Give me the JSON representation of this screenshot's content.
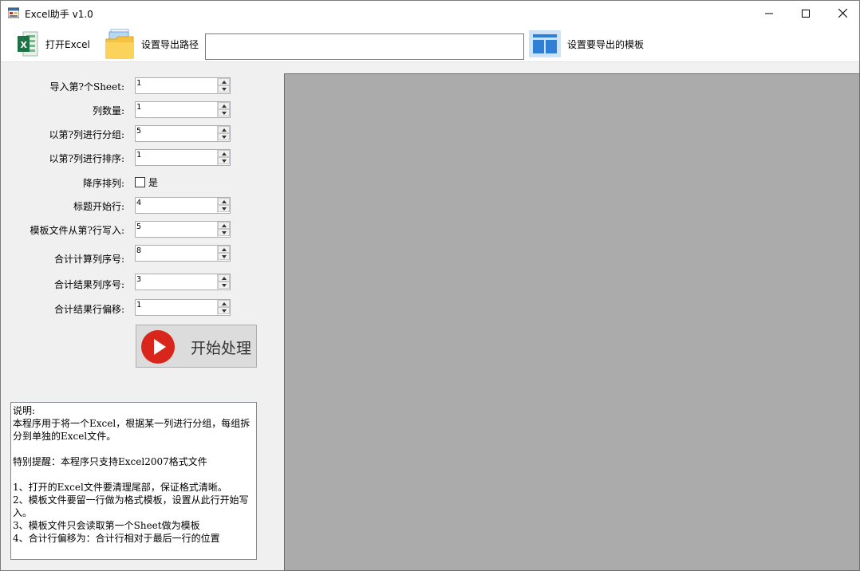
{
  "window": {
    "title": "Excel助手 v1.0"
  },
  "toolbar": {
    "open_excel_label": "打开Excel",
    "set_export_path_label": "设置导出路径",
    "export_path_value": "",
    "set_template_label": "设置要导出的模板"
  },
  "form": {
    "sheet_index": {
      "label": "导入第?个Sheet:",
      "value": "1"
    },
    "column_count": {
      "label": "列数量:",
      "value": "1"
    },
    "group_column": {
      "label": "以第?列进行分组:",
      "value": "5"
    },
    "sort_column": {
      "label": "以第?列进行排序:",
      "value": "1"
    },
    "descending": {
      "label": "降序排列:",
      "checkbox_label": "是",
      "checked": false
    },
    "header_start_row": {
      "label": "标题开始行:",
      "value": "4"
    },
    "template_write_row": {
      "label": "模板文件从第?行写入:",
      "value": "5"
    },
    "sum_calc_column": {
      "label": "合计计算列序号:",
      "value": "8"
    },
    "sum_result_column": {
      "label": "合计结果列序号:",
      "value": "3"
    },
    "sum_result_row_offset": {
      "label": "合计结果行偏移:",
      "value": "1"
    }
  },
  "start_button": {
    "label": "开始处理"
  },
  "notes": {
    "text": "说明:\n本程序用于将一个Excel，根据某一列进行分组，每组拆分到单独的Excel文件。\n\n特别提醒：本程序只支持Excel2007格式文件\n\n1、打开的Excel文件要清理尾部，保证格式清晰。\n2、模板文件要留一行做为格式模板，设置从此行开始写入。\n3、模板文件只会读取第一个Sheet做为模板\n4、合计行偏移为：合计行相对于最后一行的位置"
  },
  "colors": {
    "excel_green": "#1e7145",
    "folder_yellow": "#f5c242",
    "template_blue": "#2f7fd6",
    "start_red": "#d9261c",
    "preview_gray": "#ababab"
  },
  "icons": {
    "app": "app-icon",
    "open_excel": "excel-icon",
    "export_path": "folder-icon",
    "template": "template-icon",
    "start": "play-icon"
  }
}
